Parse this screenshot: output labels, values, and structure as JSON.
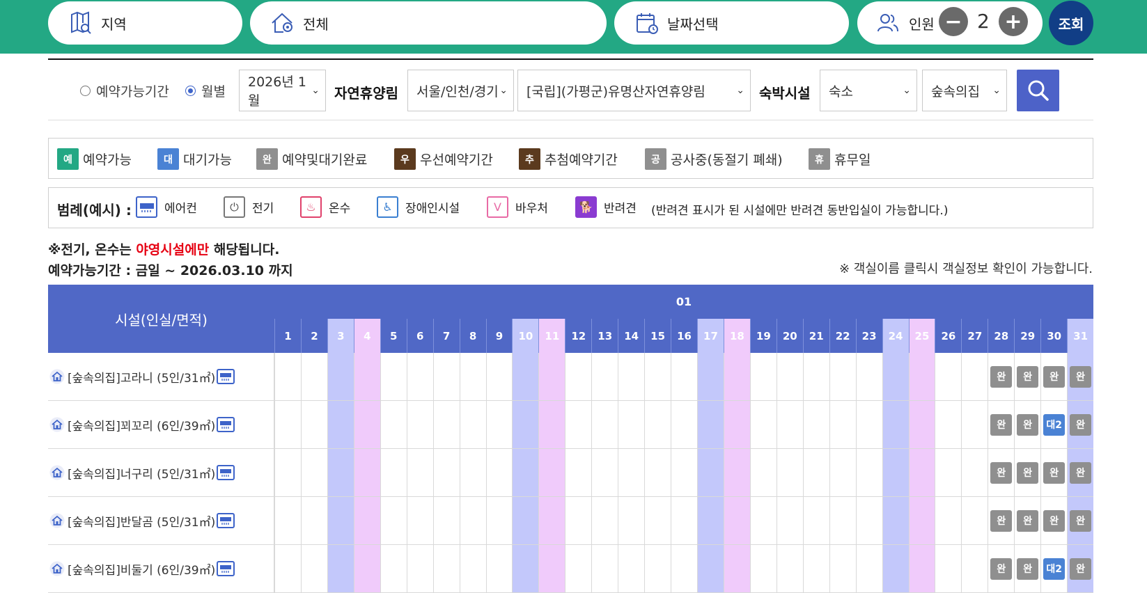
{
  "topbar": {
    "region_label": "지역",
    "all_label": "전체",
    "date_label": "날짜선택",
    "people_label": "인원",
    "people_count": "2",
    "minus_label": "−",
    "plus_label": "+",
    "search_label": "조회",
    "bg_color": "#23a884"
  },
  "filters": {
    "radio_period": "예약가능기간",
    "radio_month": "월별",
    "month_value": "2026년 1월",
    "forest_label": "자연휴양림",
    "region_value": "서울/인천/경기",
    "forest_value": "[국립](가평군)유명산자연휴양림",
    "lodging_label": "숙박시설",
    "type_value": "숙소",
    "house_value": "숲속의집"
  },
  "status_legend": [
    {
      "badge": "예",
      "label": "예약가능",
      "color": "#23a884"
    },
    {
      "badge": "대",
      "label": "대기가능",
      "color": "#4a82d4"
    },
    {
      "badge": "완",
      "label": "예약및대기완료",
      "color": "#8f8f8f"
    },
    {
      "badge": "우",
      "label": "우선예약기간",
      "color": "#5b3a1e"
    },
    {
      "badge": "추",
      "label": "추첨예약기간",
      "color": "#5b3a1e"
    },
    {
      "badge": "공",
      "label": "공사중(동절기 폐쇄)",
      "color": "#8f8f8f"
    },
    {
      "badge": "휴",
      "label": "휴무일",
      "color": "#8f8f8f"
    }
  ],
  "amenity_legend": {
    "title": "범례(예시) :",
    "items": [
      {
        "icon": "aircon-icon",
        "label": "에어컨"
      },
      {
        "icon": "electric-icon",
        "label": "전기"
      },
      {
        "icon": "hot-water-icon",
        "label": "온수"
      },
      {
        "icon": "accessible-icon",
        "label": "장애인시설"
      },
      {
        "icon": "voucher-icon",
        "label": "바우처"
      },
      {
        "icon": "pet-icon",
        "label": "반려견"
      }
    ],
    "note": "(반려견 표시가 된 시설에만 반려견 동반입실이 가능합니다.)"
  },
  "notices": {
    "line1_prefix": "※전기, 온수는 ",
    "line1_red": "야영시설에만",
    "line1_suffix": " 해당됩니다.",
    "line2": "예약가능기간 : 금일 ~ 2026.03.10 까지",
    "line3": "※ 객실이름 클릭시 객실정보 확인이 가능합니다."
  },
  "calendar": {
    "facility_header": "시설(인실/면적)",
    "month_header": "01",
    "days": [
      "1",
      "2",
      "3",
      "4",
      "5",
      "6",
      "7",
      "8",
      "9",
      "10",
      "11",
      "12",
      "13",
      "14",
      "15",
      "16",
      "17",
      "18",
      "19",
      "20",
      "21",
      "22",
      "23",
      "24",
      "25",
      "26",
      "27",
      "28",
      "29",
      "30",
      "31"
    ],
    "saturdays": [
      3,
      10,
      17,
      24,
      31
    ],
    "sundays": [
      4,
      11,
      18,
      25
    ],
    "rooms": [
      {
        "name": "[숲속의집]고라니 (5인/31㎡)",
        "status": {
          "28": "완",
          "29": "완",
          "30": "완",
          "31": "완"
        }
      },
      {
        "name": "[숲속의집]꾀꼬리 (6인/39㎡)",
        "status": {
          "28": "완",
          "29": "완",
          "30": "대2",
          "31": "완"
        }
      },
      {
        "name": "[숲속의집]너구리 (5인/31㎡)",
        "status": {
          "28": "완",
          "29": "완",
          "30": "완",
          "31": "완"
        }
      },
      {
        "name": "[숲속의집]반달곰 (5인/31㎡)",
        "status": {
          "28": "완",
          "29": "완",
          "30": "완",
          "31": "완"
        }
      },
      {
        "name": "[숲속의집]비둘기 (6인/39㎡)",
        "status": {
          "28": "완",
          "29": "완",
          "30": "대2",
          "31": "완"
        }
      }
    ]
  }
}
